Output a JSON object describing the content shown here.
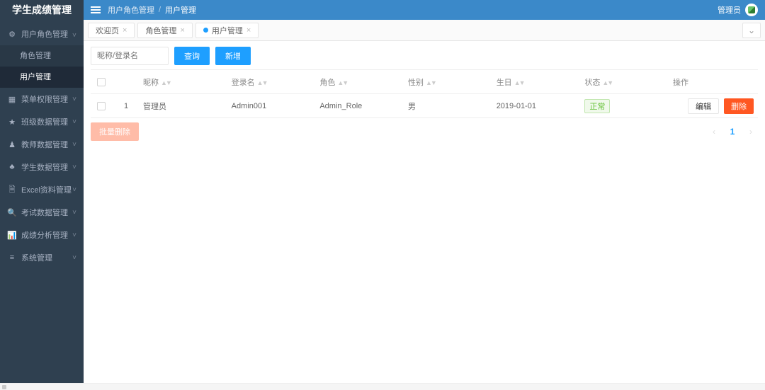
{
  "app": {
    "title": "学生成绩管理"
  },
  "header": {
    "crumb_group": "用户角色管理",
    "crumb_current": "用户管理",
    "user_label": "管理员"
  },
  "sidebar": {
    "items": [
      {
        "icon": "⚙",
        "label": "用户角色管理",
        "expanded": true,
        "children": [
          {
            "label": "角色管理",
            "active": false
          },
          {
            "label": "用户管理",
            "active": true
          }
        ]
      },
      {
        "icon": "▦",
        "label": "菜单权限管理"
      },
      {
        "icon": "★",
        "label": "班级数据管理"
      },
      {
        "icon": "♟",
        "label": "教师数据管理"
      },
      {
        "icon": "♣",
        "label": "学生数据管理"
      },
      {
        "icon": "🗎",
        "label": "Excel资料管理"
      },
      {
        "icon": "🔍",
        "label": "考试数据管理"
      },
      {
        "icon": "📊",
        "label": "成绩分析管理"
      },
      {
        "icon": "≡",
        "label": "系统管理"
      }
    ]
  },
  "tabs": {
    "items": [
      {
        "label": "欢迎页",
        "closable": true,
        "active": false
      },
      {
        "label": "角色管理",
        "closable": true,
        "active": false
      },
      {
        "label": "用户管理",
        "closable": true,
        "active": true
      }
    ],
    "more_icon": "⌄"
  },
  "toolbar": {
    "search_placeholder": "昵称/登录名",
    "search_btn": "查询",
    "add_btn": "新增"
  },
  "table": {
    "headers": {
      "nickname": "昵称",
      "login": "登录名",
      "role": "角色",
      "gender": "性别",
      "birthday": "生日",
      "status": "状态",
      "ops": "操作"
    },
    "rows": [
      {
        "idx": "1",
        "nickname": "管理员",
        "login": "Admin001",
        "role": "Admin_Role",
        "gender": "男",
        "birthday": "2019-01-01",
        "status": "正常"
      }
    ],
    "row_edit": "编辑",
    "row_delete": "删除",
    "batch_delete": "批量删除"
  },
  "pager": {
    "prev": "‹",
    "page": "1",
    "next": "›"
  }
}
